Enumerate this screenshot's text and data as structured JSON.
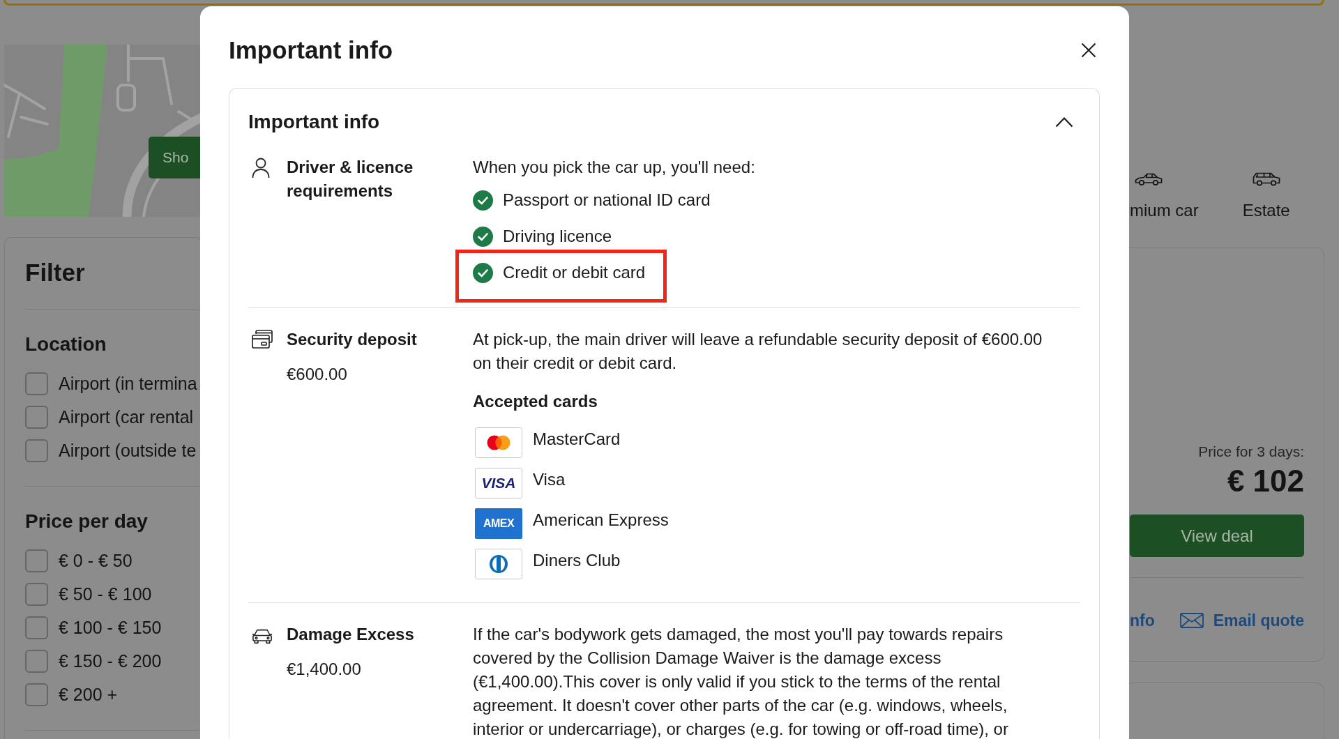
{
  "map": {
    "button": "Sho"
  },
  "filter": {
    "title": "Filter",
    "groups": [
      {
        "title": "Location",
        "options": [
          {
            "label": "Airport (in termina",
            "checked": false
          },
          {
            "label": "Airport (car rental",
            "checked": false
          },
          {
            "label": "Airport (outside te",
            "checked": false
          }
        ]
      },
      {
        "title": "Price per day",
        "options": [
          {
            "label": "€ 0 - € 50",
            "checked": false
          },
          {
            "label": "€ 50 - € 100",
            "checked": false
          },
          {
            "label": "€ 100 - € 150",
            "checked": false
          },
          {
            "label": "€ 150 - € 200",
            "checked": false
          },
          {
            "label": "€ 200 +",
            "checked": false
          }
        ]
      }
    ]
  },
  "car_types": [
    {
      "label": "mium car",
      "kind": "sedan"
    },
    {
      "label": "Estate",
      "kind": "estate"
    }
  ],
  "result": {
    "price_caption": "Price for 3 days:",
    "price": "€ 102",
    "button": "View deal",
    "links": [
      {
        "label": "nfo",
        "kind": "info"
      },
      {
        "label": "Email quote",
        "kind": "email"
      }
    ]
  },
  "modal": {
    "title": "Important info",
    "section": {
      "title": "Important info",
      "expanded": true,
      "items": [
        {
          "kind": "driver",
          "label": "Driver & licence requirements",
          "intro": "When you pick the car up, you'll need:",
          "requirements": [
            {
              "label": "Passport or national ID card",
              "highlighted": false
            },
            {
              "label": "Driving licence",
              "highlighted": false
            },
            {
              "label": "Credit or debit card",
              "highlighted": true
            }
          ]
        },
        {
          "kind": "deposit",
          "label": "Security deposit",
          "value": "€600.00",
          "text": "At pick-up, the main driver will leave a refundable security deposit of €600.00 on their credit or debit card.",
          "cards_title": "Accepted cards",
          "cards": [
            {
              "kind": "mastercard",
              "name": "MasterCard"
            },
            {
              "kind": "visa",
              "name": "Visa",
              "logo_text": "VISA"
            },
            {
              "kind": "amex",
              "name": "American Express",
              "logo_text": "AMEX"
            },
            {
              "kind": "diners",
              "name": "Diners Club"
            }
          ]
        },
        {
          "kind": "damage",
          "label": "Damage Excess",
          "value": "€1,400.00",
          "text": "If the car's bodywork gets damaged, the most you'll pay towards repairs covered by the Collision Damage Waiver is the damage excess (€1,400.00).This cover is only valid if you stick to the terms of the rental agreement. It doesn't cover other parts of the car (e.g. windows, wheels, interior or undercarriage), or charges (e.g. for towing or off-road time), or"
        }
      ]
    }
  }
}
